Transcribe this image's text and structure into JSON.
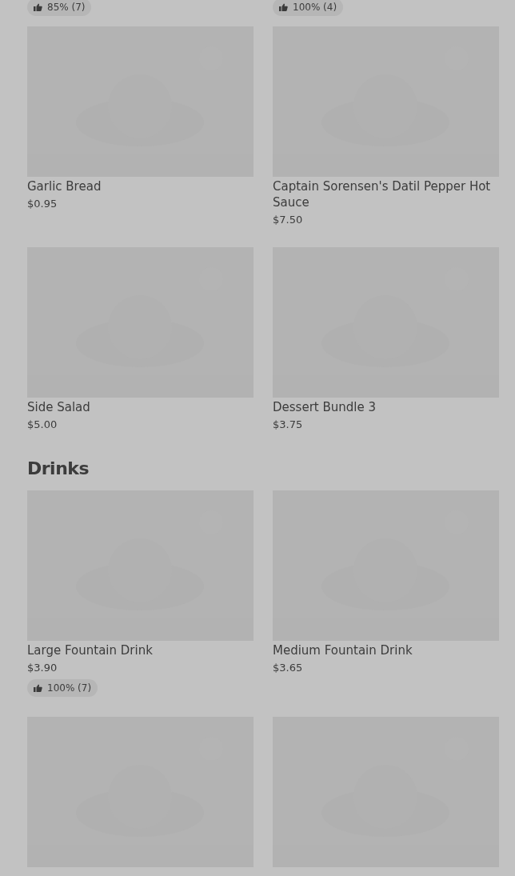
{
  "top_ratings": [
    {
      "rating": "85% (7)"
    },
    {
      "rating": "100% (4)"
    }
  ],
  "sections": [
    {
      "items": [
        {
          "kind": "product",
          "name": "Garlic Bread",
          "price": "$0.95"
        },
        {
          "kind": "product",
          "name": "Captain Sorensen's Datil Pepper Hot Sauce",
          "price": "$7.50"
        },
        {
          "kind": "product",
          "name": "Side Salad",
          "price": "$5.00"
        },
        {
          "kind": "product",
          "name": "Dessert Bundle 3",
          "price": "$3.75"
        }
      ]
    },
    {
      "title": "Drinks",
      "items": [
        {
          "kind": "product",
          "name": "Large Fountain Drink",
          "price": "$3.90",
          "rating": "100% (7)"
        },
        {
          "kind": "product",
          "name": "Medium Fountain Drink",
          "price": "$3.65"
        },
        {
          "kind": "picture"
        },
        {
          "kind": "picture"
        }
      ]
    }
  ]
}
